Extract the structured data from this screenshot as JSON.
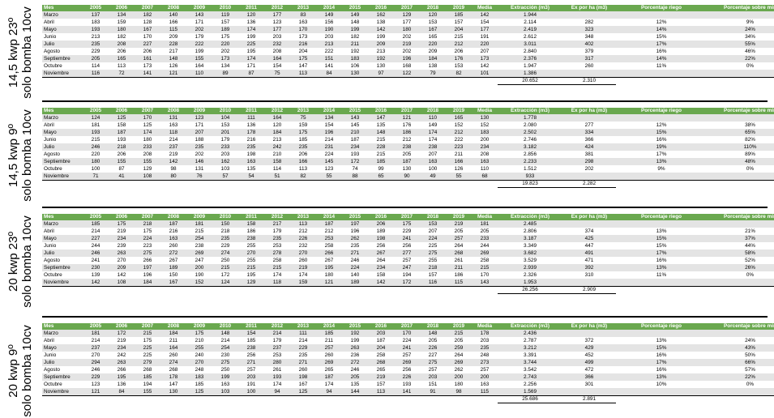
{
  "headers": [
    "Mes",
    "2005",
    "2006",
    "2007",
    "2008",
    "2009",
    "2010",
    "2011",
    "2012",
    "2013",
    "2014",
    "2015",
    "2016",
    "2017",
    "2018",
    "2019",
    "Media",
    "Extracción (m3)",
    "Ex por ha (m3)",
    "Porcentaje riego",
    "Porcentaje sobre min"
  ],
  "sections": [
    {
      "label_line1": "14,5 kwp 23º",
      "label_line2": "solo bomba 10cv",
      "rows": [
        [
          "Marzo",
          "137",
          "134",
          "182",
          "140",
          "143",
          "119",
          "120",
          "177",
          "83",
          "149",
          "149",
          "162",
          "129",
          "120",
          "185",
          "142",
          "1.944",
          "",
          "",
          ""
        ],
        [
          "Abril",
          "183",
          "159",
          "128",
          "166",
          "171",
          "157",
          "136",
          "123",
          "163",
          "156",
          "148",
          "138",
          "177",
          "153",
          "157",
          "154",
          "2.114",
          "282",
          "12%",
          "9%"
        ],
        [
          "Mayo",
          "193",
          "180",
          "167",
          "115",
          "202",
          "189",
          "174",
          "177",
          "170",
          "190",
          "199",
          "142",
          "180",
          "167",
          "204",
          "177",
          "2.419",
          "323",
          "14%",
          "24%"
        ],
        [
          "Junio",
          "213",
          "182",
          "170",
          "209",
          "179",
          "175",
          "199",
          "203",
          "173",
          "203",
          "182",
          "199",
          "202",
          "165",
          "215",
          "191",
          "2.612",
          "348",
          "15%",
          "34%"
        ],
        [
          "Julio",
          "235",
          "208",
          "227",
          "228",
          "222",
          "220",
          "225",
          "232",
          "216",
          "213",
          "211",
          "209",
          "219",
          "220",
          "212",
          "220",
          "3.011",
          "402",
          "17%",
          "55%"
        ],
        [
          "Agosto",
          "229",
          "206",
          "206",
          "217",
          "199",
          "202",
          "195",
          "208",
          "204",
          "222",
          "192",
          "213",
          "202",
          "209",
          "206",
          "207",
          "2.840",
          "379",
          "16%",
          "46%"
        ],
        [
          "Septiembre",
          "205",
          "165",
          "161",
          "148",
          "155",
          "173",
          "174",
          "164",
          "175",
          "151",
          "183",
          "192",
          "196",
          "184",
          "176",
          "173",
          "2.376",
          "317",
          "14%",
          "22%"
        ],
        [
          "Octubre",
          "114",
          "113",
          "173",
          "126",
          "164",
          "134",
          "171",
          "154",
          "147",
          "141",
          "106",
          "130",
          "168",
          "138",
          "153",
          "142",
          "1.947",
          "260",
          "11%",
          "0%"
        ],
        [
          "Noviembre",
          "116",
          "72",
          "141",
          "121",
          "110",
          "89",
          "87",
          "75",
          "113",
          "84",
          "130",
          "97",
          "122",
          "79",
          "82",
          "101",
          "1.386",
          "",
          "",
          ""
        ]
      ],
      "total_extraction": "20.652",
      "total_per_ha": "2.310"
    },
    {
      "label_line1": "14,5 kwp 9º",
      "label_line2": "solo bomba 10cv",
      "rows": [
        [
          "Marzo",
          "124",
          "125",
          "170",
          "131",
          "123",
          "104",
          "111",
          "164",
          "75",
          "134",
          "143",
          "147",
          "121",
          "110",
          "165",
          "130",
          "1.778",
          "",
          "",
          ""
        ],
        [
          "Abril",
          "181",
          "158",
          "125",
          "163",
          "171",
          "153",
          "136",
          "120",
          "159",
          "154",
          "145",
          "135",
          "176",
          "149",
          "152",
          "152",
          "2.080",
          "277",
          "12%",
          "38%"
        ],
        [
          "Mayo",
          "193",
          "187",
          "174",
          "118",
          "207",
          "201",
          "178",
          "184",
          "175",
          "196",
          "210",
          "148",
          "186",
          "174",
          "212",
          "183",
          "2.502",
          "334",
          "15%",
          "65%"
        ],
        [
          "Junio",
          "215",
          "193",
          "180",
          "214",
          "188",
          "179",
          "216",
          "213",
          "185",
          "214",
          "187",
          "215",
          "212",
          "174",
          "222",
          "200",
          "2.746",
          "366",
          "16%",
          "82%"
        ],
        [
          "Julio",
          "246",
          "218",
          "233",
          "237",
          "235",
          "233",
          "235",
          "242",
          "235",
          "231",
          "234",
          "228",
          "238",
          "238",
          "223",
          "234",
          "3.182",
          "424",
          "19%",
          "110%"
        ],
        [
          "Agosto",
          "220",
          "206",
          "208",
          "219",
          "202",
          "203",
          "198",
          "210",
          "206",
          "224",
          "193",
          "215",
          "205",
          "207",
          "211",
          "208",
          "2.856",
          "381",
          "17%",
          "89%"
        ],
        [
          "Septiembre",
          "180",
          "155",
          "155",
          "142",
          "146",
          "162",
          "163",
          "158",
          "166",
          "145",
          "172",
          "185",
          "187",
          "163",
          "166",
          "163",
          "2.233",
          "298",
          "13%",
          "48%"
        ],
        [
          "Octubre",
          "100",
          "87",
          "129",
          "98",
          "131",
          "103",
          "135",
          "114",
          "113",
          "123",
          "74",
          "99",
          "130",
          "100",
          "126",
          "110",
          "1.512",
          "202",
          "9%",
          "0%"
        ],
        [
          "Noviembre",
          "71",
          "41",
          "108",
          "80",
          "76",
          "57",
          "54",
          "51",
          "82",
          "55",
          "88",
          "65",
          "90",
          "49",
          "55",
          "68",
          "933",
          "",
          "",
          ""
        ]
      ],
      "total_extraction": "19.823",
      "total_per_ha": "2.282"
    },
    {
      "label_line1": "20 kwp 23º",
      "label_line2": "solo bomba 10cv",
      "rows": [
        [
          "Marzo",
          "185",
          "175",
          "218",
          "187",
          "181",
          "150",
          "158",
          "217",
          "113",
          "187",
          "197",
          "206",
          "175",
          "153",
          "219",
          "181",
          "2.485",
          "",
          "",
          ""
        ],
        [
          "Abril",
          "214",
          "219",
          "175",
          "216",
          "215",
          "218",
          "186",
          "179",
          "212",
          "212",
          "196",
          "189",
          "229",
          "207",
          "205",
          "205",
          "2.806",
          "374",
          "13%",
          "21%"
        ],
        [
          "Mayo",
          "227",
          "234",
          "224",
          "163",
          "254",
          "235",
          "238",
          "235",
          "226",
          "253",
          "262",
          "198",
          "241",
          "224",
          "257",
          "233",
          "3.187",
          "425",
          "15%",
          "37%"
        ],
        [
          "Junio",
          "244",
          "239",
          "223",
          "260",
          "238",
          "229",
          "255",
          "253",
          "232",
          "258",
          "235",
          "256",
          "256",
          "225",
          "264",
          "244",
          "3.349",
          "447",
          "15%",
          "44%"
        ],
        [
          "Julio",
          "246",
          "263",
          "275",
          "272",
          "269",
          "274",
          "270",
          "278",
          "270",
          "266",
          "271",
          "267",
          "277",
          "275",
          "268",
          "269",
          "3.682",
          "491",
          "17%",
          "58%"
        ],
        [
          "Agosto",
          "241",
          "270",
          "266",
          "267",
          "247",
          "250",
          "255",
          "258",
          "260",
          "267",
          "246",
          "264",
          "257",
          "255",
          "261",
          "258",
          "3.529",
          "471",
          "16%",
          "52%"
        ],
        [
          "Septiembre",
          "230",
          "209",
          "197",
          "189",
          "200",
          "215",
          "215",
          "215",
          "219",
          "195",
          "224",
          "234",
          "247",
          "218",
          "211",
          "215",
          "2.939",
          "392",
          "13%",
          "26%"
        ],
        [
          "Octubre",
          "139",
          "142",
          "196",
          "150",
          "190",
          "172",
          "195",
          "174",
          "174",
          "180",
          "140",
          "158",
          "194",
          "157",
          "186",
          "170",
          "2.326",
          "310",
          "11%",
          "0%"
        ],
        [
          "Noviembre",
          "142",
          "108",
          "184",
          "167",
          "152",
          "124",
          "129",
          "118",
          "159",
          "121",
          "189",
          "142",
          "172",
          "116",
          "115",
          "143",
          "1.953",
          "",
          "",
          ""
        ]
      ],
      "total_extraction": "26.256",
      "total_per_ha": "2.909"
    },
    {
      "label_line1": "20 kwp 9º",
      "label_line2": "solo bomba 10cv",
      "rows": [
        [
          "Marzo",
          "181",
          "172",
          "215",
          "184",
          "175",
          "148",
          "154",
          "214",
          "111",
          "185",
          "192",
          "203",
          "170",
          "148",
          "215",
          "178",
          "2.436",
          "",
          "",
          ""
        ],
        [
          "Abril",
          "214",
          "219",
          "175",
          "211",
          "210",
          "214",
          "185",
          "179",
          "214",
          "211",
          "199",
          "187",
          "224",
          "205",
          "205",
          "203",
          "2.787",
          "372",
          "13%",
          "24%"
        ],
        [
          "Mayo",
          "237",
          "234",
          "225",
          "164",
          "255",
          "254",
          "238",
          "237",
          "229",
          "257",
          "263",
          "204",
          "241",
          "226",
          "259",
          "235",
          "3.212",
          "429",
          "15%",
          "43%"
        ],
        [
          "Junio",
          "270",
          "242",
          "225",
          "260",
          "240",
          "230",
          "256",
          "253",
          "235",
          "260",
          "236",
          "258",
          "257",
          "227",
          "264",
          "248",
          "3.391",
          "452",
          "16%",
          "50%"
        ],
        [
          "Julio",
          "294",
          "263",
          "279",
          "274",
          "270",
          "275",
          "271",
          "280",
          "271",
          "269",
          "272",
          "268",
          "269",
          "275",
          "269",
          "273",
          "3.744",
          "499",
          "17%",
          "66%"
        ],
        [
          "Agosto",
          "246",
          "266",
          "268",
          "268",
          "248",
          "250",
          "257",
          "261",
          "260",
          "265",
          "246",
          "265",
          "256",
          "257",
          "262",
          "257",
          "3.542",
          "472",
          "16%",
          "57%"
        ],
        [
          "Septiembre",
          "229",
          "195",
          "185",
          "178",
          "183",
          "199",
          "203",
          "193",
          "198",
          "187",
          "205",
          "219",
          "226",
          "203",
          "200",
          "200",
          "2.743",
          "366",
          "13%",
          "22%"
        ],
        [
          "Octubre",
          "123",
          "136",
          "194",
          "147",
          "185",
          "163",
          "191",
          "174",
          "167",
          "174",
          "135",
          "157",
          "193",
          "151",
          "180",
          "163",
          "2.256",
          "301",
          "10%",
          "0%"
        ],
        [
          "Noviembre",
          "121",
          "84",
          "155",
          "130",
          "125",
          "103",
          "100",
          "94",
          "125",
          "94",
          "144",
          "113",
          "141",
          "91",
          "98",
          "115",
          "1.569",
          "",
          "",
          ""
        ]
      ],
      "total_extraction": "25.686",
      "total_per_ha": "2.891"
    }
  ]
}
